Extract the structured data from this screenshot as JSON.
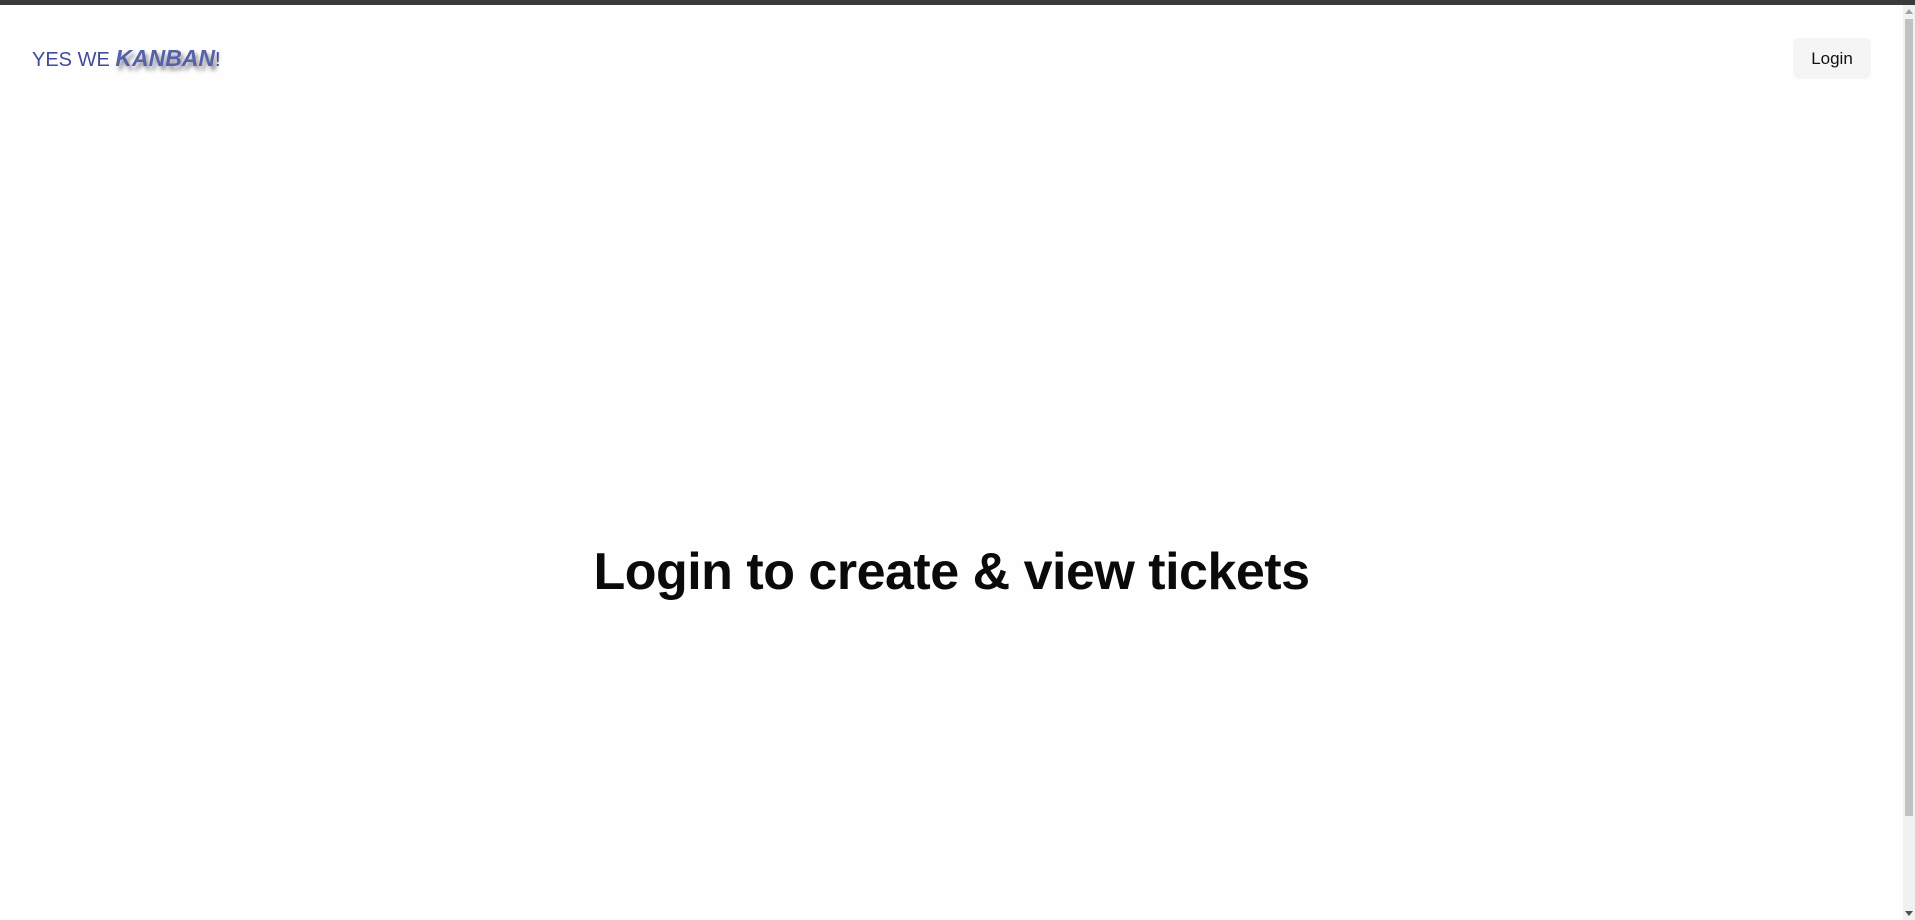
{
  "navbar": {
    "brand": {
      "prefix": "YES WE ",
      "emphasis": "KANBAN",
      "suffix": "!",
      "color": "#3f4c9b"
    },
    "login_label": "Login"
  },
  "main": {
    "headline": "Login to create & view tickets"
  },
  "scrollbar": {
    "visible_fraction": 0.87
  }
}
